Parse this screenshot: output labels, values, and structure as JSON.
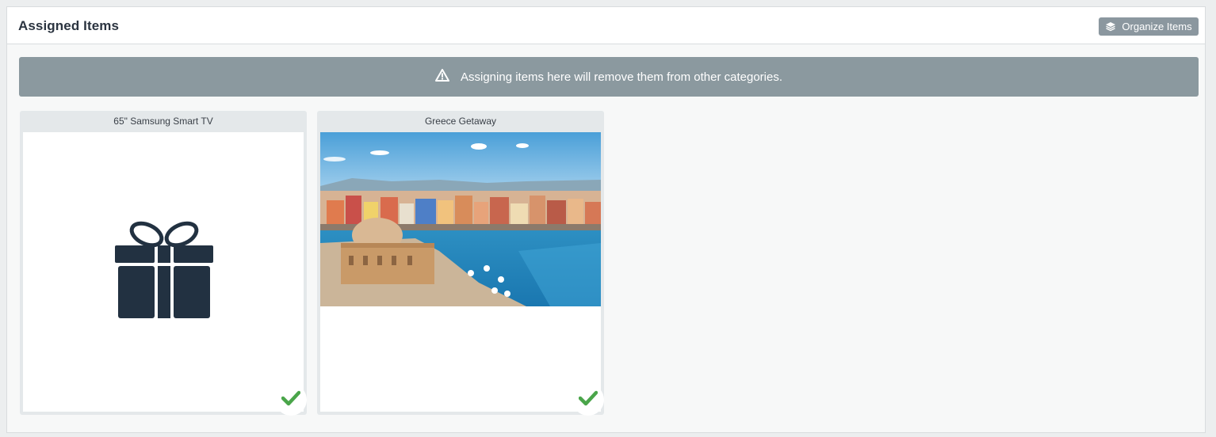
{
  "header": {
    "title": "Assigned Items",
    "organize_button": {
      "label": "Organize Items",
      "icon": "layers-icon"
    }
  },
  "alert": {
    "icon": "warning-icon",
    "message": "Assigning items here will remove them from other categories."
  },
  "items": [
    {
      "title": "65\" Samsung Smart TV",
      "image": "gift-icon",
      "status_icon": "checkmark-icon"
    },
    {
      "title": "Greece Getaway",
      "image": "harbor-photo",
      "status_icon": "checkmark-icon"
    }
  ],
  "colors": {
    "alert_bg": "#8b999f",
    "button_bg": "#8b979f",
    "check_green": "#4aa54a",
    "gift_dark": "#223141"
  }
}
